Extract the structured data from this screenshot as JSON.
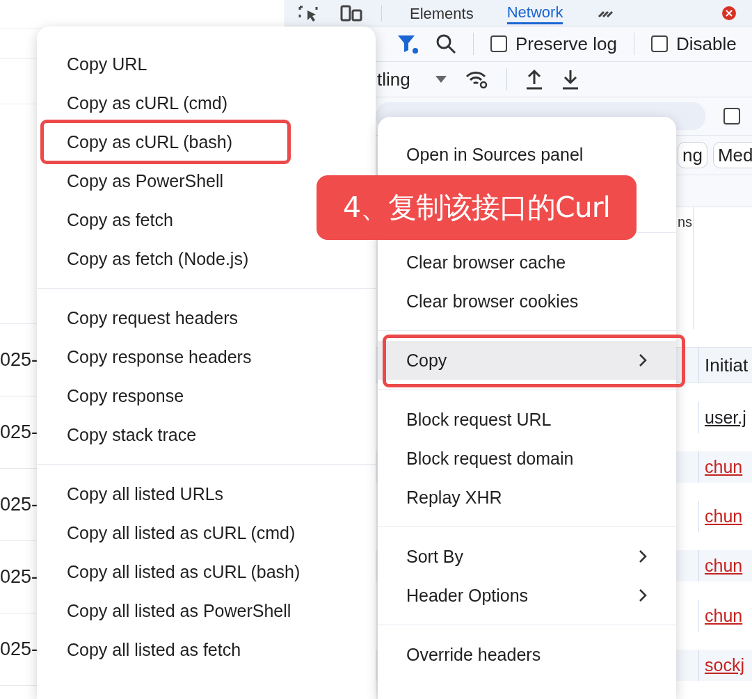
{
  "left_rows": [
    "025-",
    "025-",
    "025-",
    "025-",
    "025-"
  ],
  "devtools": {
    "tabs": [
      {
        "label": "Elements",
        "selected": false
      },
      {
        "label": "Network",
        "selected": true
      }
    ],
    "checkboxes": [
      {
        "label": "Preserve log",
        "checked": false
      },
      {
        "label": "Disable",
        "checked": false
      }
    ],
    "throttling": "tling",
    "filter_checkbox": {
      "checked": false
    },
    "chips": [
      "ng",
      "Med"
    ],
    "column_fragment": "ns",
    "initiator_header": "Initiat",
    "initiators": [
      {
        "text": "user.j",
        "kind": "script"
      },
      {
        "text": "chun",
        "kind": "failed"
      },
      {
        "text": "chun",
        "kind": "failed"
      },
      {
        "text": "chun",
        "kind": "failed"
      },
      {
        "text": "chun",
        "kind": "failed"
      },
      {
        "text": "sockj",
        "kind": "failed"
      }
    ]
  },
  "copy_submenu": {
    "groups": [
      {
        "items": [
          {
            "label": "Copy URL",
            "submenu": false,
            "selected": false,
            "outlined": false
          },
          {
            "label": "Copy as cURL (cmd)",
            "submenu": false,
            "selected": false,
            "outlined": false
          },
          {
            "label": "Copy as cURL (bash)",
            "submenu": false,
            "selected": false,
            "outlined": true
          },
          {
            "label": "Copy as PowerShell",
            "submenu": false,
            "selected": false,
            "outlined": false
          },
          {
            "label": "Copy as fetch",
            "submenu": false,
            "selected": false,
            "outlined": false
          },
          {
            "label": "Copy as fetch (Node.js)",
            "submenu": false,
            "selected": false,
            "outlined": false
          }
        ]
      },
      {
        "items": [
          {
            "label": "Copy request headers",
            "submenu": false,
            "selected": false,
            "outlined": false
          },
          {
            "label": "Copy response headers",
            "submenu": false,
            "selected": false,
            "outlined": false
          },
          {
            "label": "Copy response",
            "submenu": false,
            "selected": false,
            "outlined": false
          },
          {
            "label": "Copy stack trace",
            "submenu": false,
            "selected": false,
            "outlined": false
          }
        ]
      },
      {
        "items": [
          {
            "label": "Copy all listed URLs",
            "submenu": false,
            "selected": false,
            "outlined": false
          },
          {
            "label": "Copy all listed as cURL (cmd)",
            "submenu": false,
            "selected": false,
            "outlined": false
          },
          {
            "label": "Copy all listed as cURL (bash)",
            "submenu": false,
            "selected": false,
            "outlined": false
          },
          {
            "label": "Copy all listed as PowerShell",
            "submenu": false,
            "selected": false,
            "outlined": false
          },
          {
            "label": "Copy all listed as fetch",
            "submenu": false,
            "selected": false,
            "outlined": false
          }
        ]
      }
    ]
  },
  "context_menu": {
    "groups": [
      {
        "items": [
          {
            "label": "Open in Sources panel",
            "submenu": false,
            "selected": false,
            "outlined": false
          }
        ]
      },
      {
        "items": [
          {
            "label": "Clear browser cache",
            "submenu": false,
            "selected": false,
            "outlined": false
          },
          {
            "label": "Clear browser cookies",
            "submenu": false,
            "selected": false,
            "outlined": false
          }
        ]
      },
      {
        "items": [
          {
            "label": "Copy",
            "submenu": true,
            "selected": true,
            "outlined": true
          }
        ]
      },
      {
        "items": [
          {
            "label": "Block request URL",
            "submenu": false,
            "selected": false,
            "outlined": false
          },
          {
            "label": "Block request domain",
            "submenu": false,
            "selected": false,
            "outlined": false
          },
          {
            "label": "Replay XHR",
            "submenu": false,
            "selected": false,
            "outlined": false
          }
        ]
      },
      {
        "items": [
          {
            "label": "Sort By",
            "submenu": true,
            "selected": false,
            "outlined": false
          },
          {
            "label": "Header Options",
            "submenu": true,
            "selected": false,
            "outlined": false
          }
        ]
      },
      {
        "items": [
          {
            "label": "Override headers",
            "submenu": false,
            "selected": false,
            "outlined": false
          }
        ]
      }
    ]
  },
  "annotation": "4、复制该接口的Curl"
}
